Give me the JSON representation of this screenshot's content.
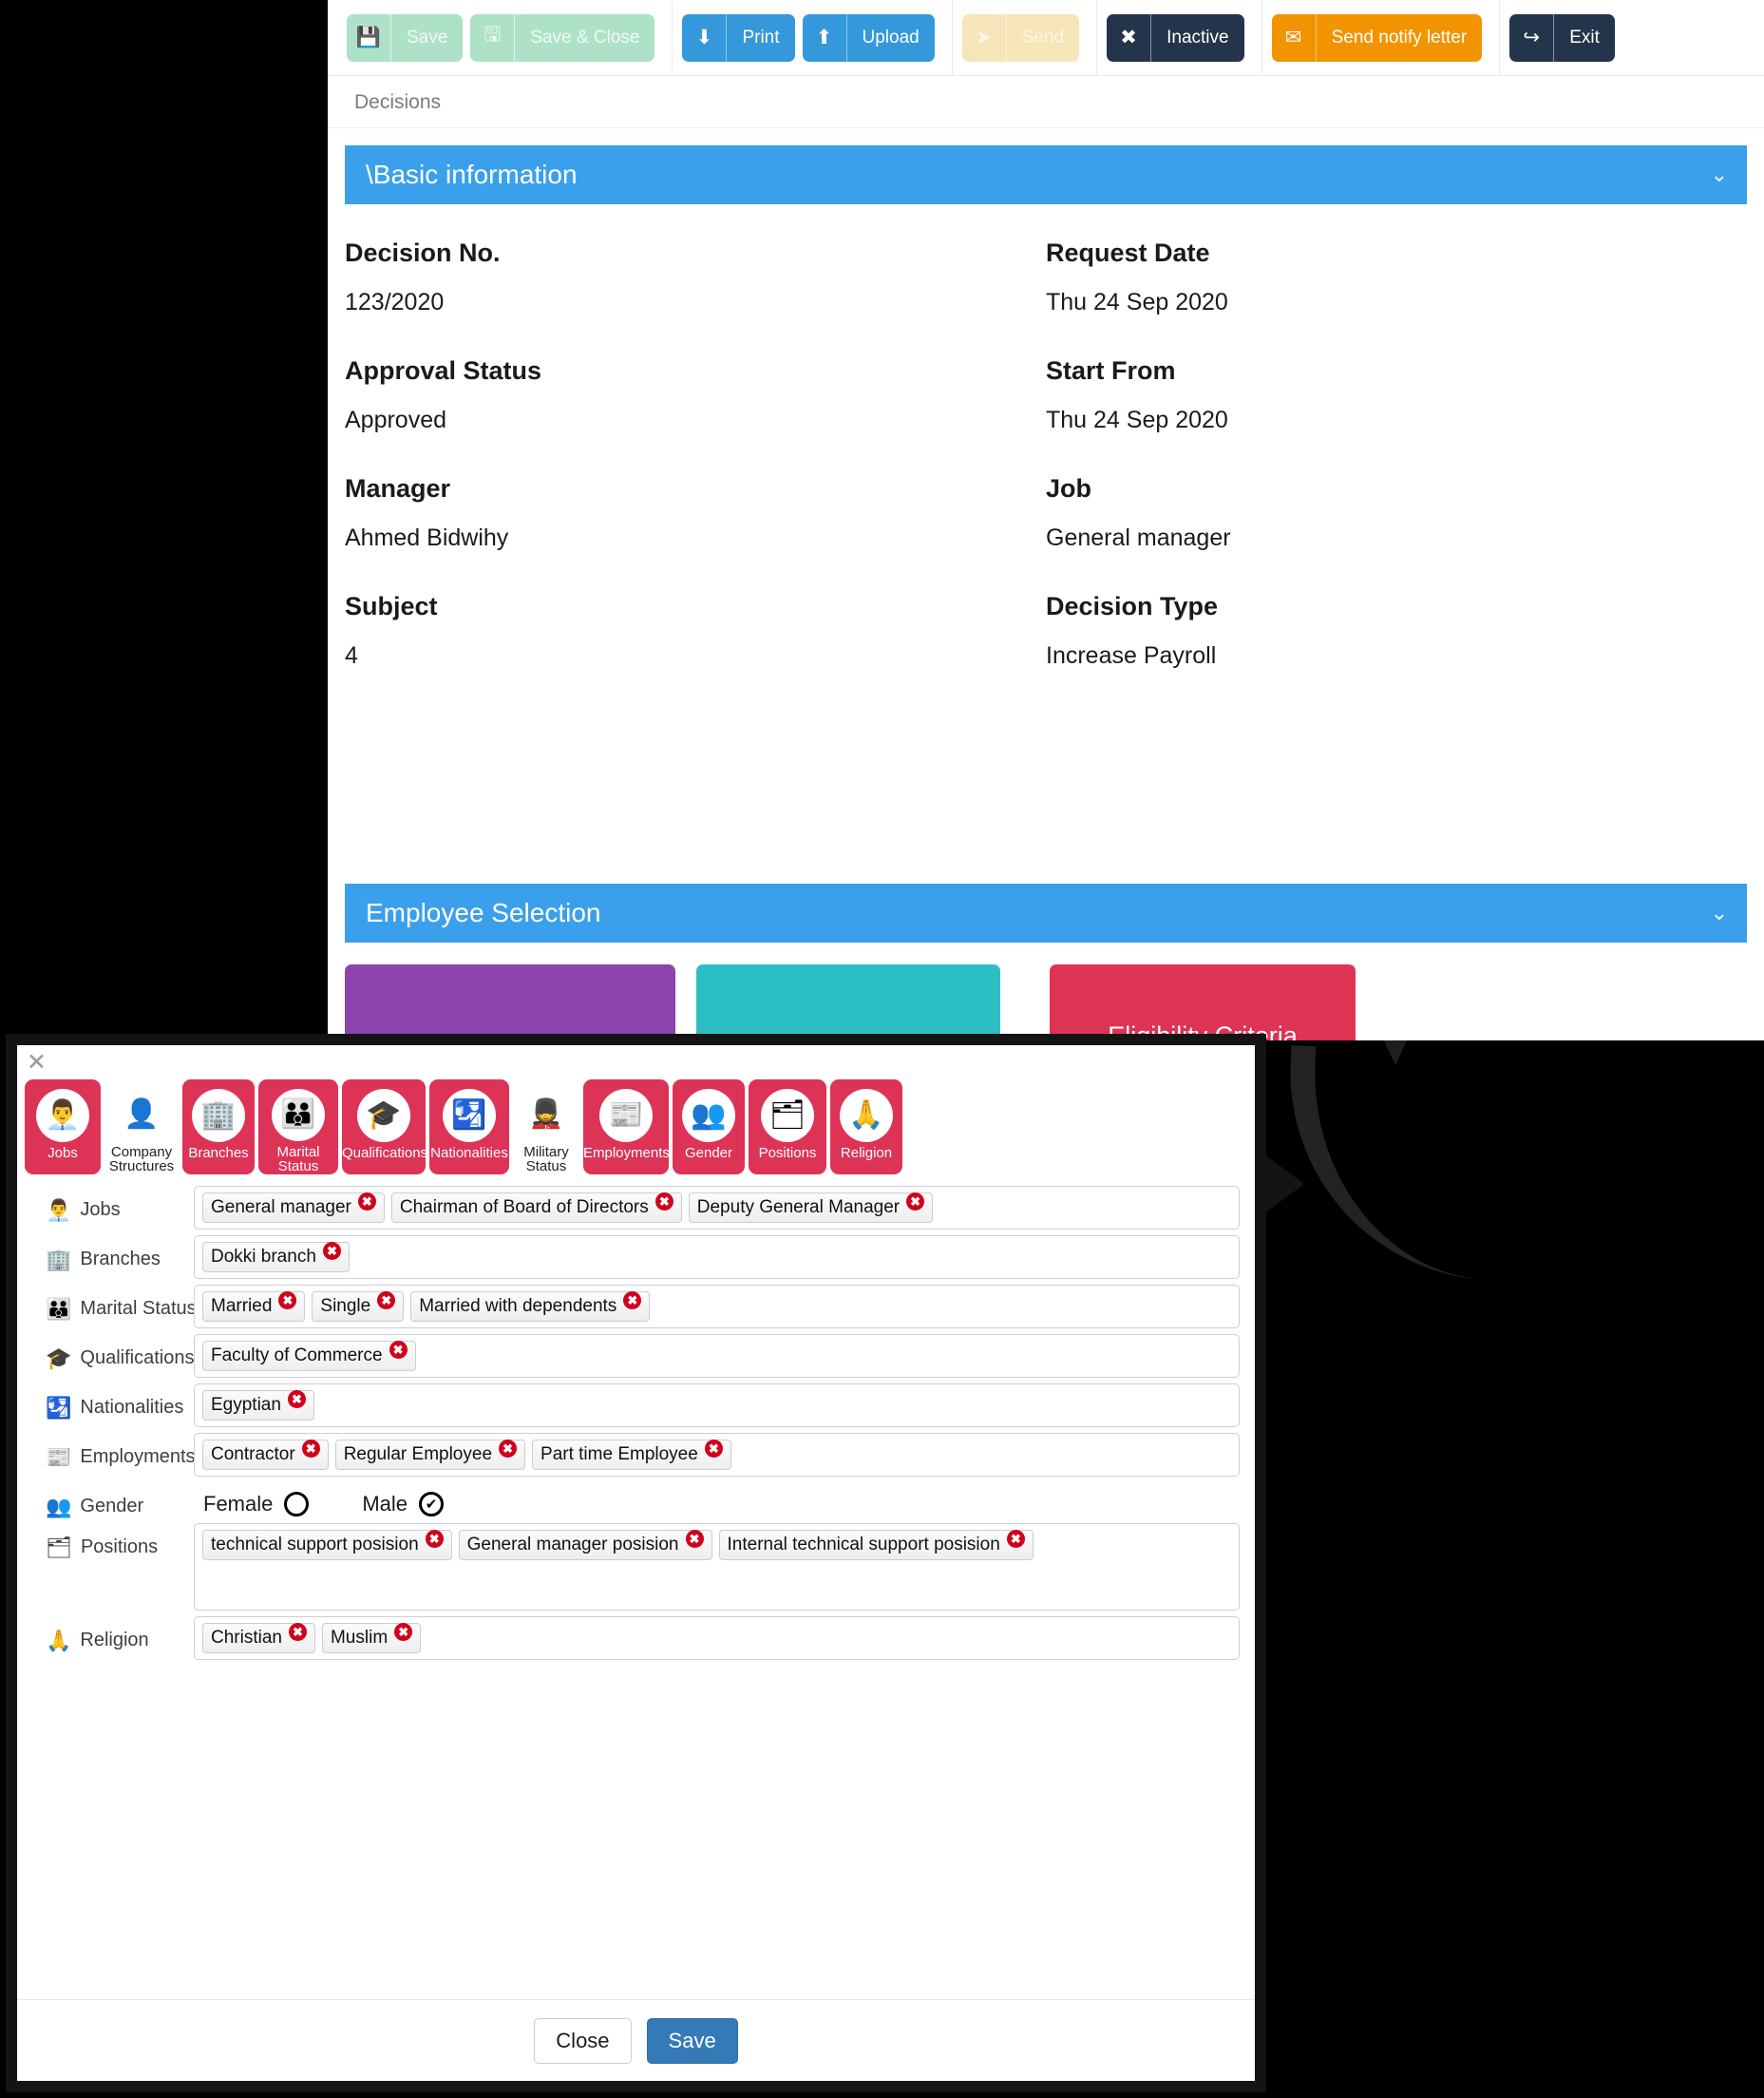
{
  "toolbar": {
    "groups": [
      {
        "buttons": [
          {
            "label": "Save",
            "icon": "save-icon",
            "glyph": "💾",
            "style": "mint",
            "name": "save-button"
          },
          {
            "label": "Save & Close",
            "icon": "save-close-icon",
            "glyph": "🖫",
            "style": "mint",
            "name": "save-close-button"
          }
        ]
      },
      {
        "buttons": [
          {
            "label": "Print",
            "icon": "print-download-icon",
            "glyph": "⬇",
            "style": "blue",
            "name": "print-button"
          },
          {
            "label": "Upload",
            "icon": "upload-icon",
            "glyph": "⬆",
            "style": "blue",
            "name": "upload-button"
          }
        ]
      },
      {
        "buttons": [
          {
            "label": "Send",
            "icon": "send-paper-plane-icon",
            "glyph": "➤",
            "style": "sand",
            "name": "send-button"
          }
        ]
      },
      {
        "buttons": [
          {
            "label": "Inactive",
            "icon": "x-mark-icon",
            "glyph": "✖",
            "style": "navy",
            "name": "inactive-button"
          }
        ]
      },
      {
        "buttons": [
          {
            "label": "Send notify letter",
            "icon": "envelope-icon",
            "glyph": "✉",
            "style": "orange",
            "name": "send-notify-letter-button"
          }
        ]
      },
      {
        "buttons": [
          {
            "label": "Exit",
            "icon": "exit-logout-icon",
            "glyph": "↪",
            "style": "navy",
            "name": "exit-button"
          }
        ]
      }
    ]
  },
  "breadcrumb": "Decisions",
  "sections": {
    "basic_information": {
      "title": "\\Basic information",
      "chevron": "⌄",
      "fields": [
        {
          "label": "Decision No.",
          "value": "123/2020"
        },
        {
          "label": "Request Date",
          "value": "Thu 24 Sep 2020"
        },
        {
          "label": "Approval Status",
          "value": "Approved"
        },
        {
          "label": "Start From",
          "value": "Thu 24 Sep 2020"
        },
        {
          "label": "Manager",
          "value": "Ahmed Bidwihy"
        },
        {
          "label": "Job",
          "value": "General manager"
        },
        {
          "label": "Subject",
          "value": "4"
        },
        {
          "label": "Decision Type",
          "value": "Increase Payroll"
        }
      ]
    },
    "employee_selection": {
      "title": "Employee Selection",
      "chevron": "⌄",
      "cards": [
        {
          "label": "",
          "color": "#8e44ad",
          "name": "employee-card-purple"
        },
        {
          "label": "",
          "color": "#2bbfc4",
          "name": "employee-card-teal"
        },
        {
          "label": "Eligibility Criteria",
          "color": "#dd3354",
          "name": "eligibility-criteria-card"
        }
      ]
    }
  },
  "modal": {
    "close_glyph": "✕",
    "tabs": [
      {
        "label": "Jobs",
        "glyph": "👨‍💼",
        "active": true,
        "icon": "jobs-icon",
        "cls": "w-jobs"
      },
      {
        "label": "Company Structures",
        "glyph": "👤",
        "active": false,
        "icon": "company-structures-icon",
        "cls": "w-company"
      },
      {
        "label": "Branches",
        "glyph": "🏢",
        "active": true,
        "icon": "branches-icon",
        "cls": "w-branches"
      },
      {
        "label": "Marital Status",
        "glyph": "👪",
        "active": true,
        "icon": "marital-status-icon",
        "cls": "w-marital"
      },
      {
        "label": "Qualifications",
        "glyph": "🎓",
        "active": true,
        "icon": "qualifications-icon",
        "cls": "w-qual"
      },
      {
        "label": "Nationalities",
        "glyph": "🛂",
        "active": true,
        "icon": "nationalities-icon",
        "cls": "w-nation"
      },
      {
        "label": "Military Status",
        "glyph": "💂",
        "active": false,
        "icon": "military-status-icon",
        "cls": "w-military"
      },
      {
        "label": "Employments",
        "glyph": "📰",
        "active": true,
        "icon": "employments-icon",
        "cls": "w-employ"
      },
      {
        "label": "Gender",
        "glyph": "👥",
        "active": true,
        "icon": "gender-icon",
        "cls": "w-gender"
      },
      {
        "label": "Positions",
        "glyph": "🗂",
        "active": true,
        "icon": "positions-icon",
        "cls": "w-positions"
      },
      {
        "label": "Religion",
        "glyph": "🙏",
        "active": true,
        "icon": "religion-icon",
        "cls": "w-religion"
      }
    ],
    "rows": [
      {
        "label": "Jobs",
        "glyph": "👨‍💼",
        "icon": "jobs-icon",
        "type": "tags",
        "tall": false,
        "tags": [
          "General manager",
          "Chairman of Board of Directors",
          "Deputy General Manager"
        ]
      },
      {
        "label": "Branches",
        "glyph": "🏢",
        "icon": "branches-icon",
        "type": "tags",
        "tall": false,
        "tags": [
          "Dokki branch"
        ]
      },
      {
        "label": "Marital Status",
        "glyph": "👪",
        "icon": "marital-status-icon",
        "type": "tags",
        "tall": false,
        "tags": [
          "Married",
          "Single",
          "Married with dependents"
        ]
      },
      {
        "label": "Qualifications",
        "glyph": "🎓",
        "icon": "qualifications-icon",
        "type": "tags",
        "tall": false,
        "tags": [
          "Faculty of Commerce"
        ]
      },
      {
        "label": "Nationalities",
        "glyph": "🛂",
        "icon": "nationalities-icon",
        "type": "tags",
        "tall": false,
        "tags": [
          "Egyptian"
        ]
      },
      {
        "label": "Employments",
        "glyph": "📰",
        "icon": "employments-icon",
        "type": "tags",
        "tall": false,
        "tags": [
          "Contractor",
          "Regular Employee",
          "Part time Employee"
        ]
      },
      {
        "label": "Gender",
        "glyph": "👥",
        "icon": "gender-icon",
        "type": "radio",
        "options": [
          {
            "label": "Female",
            "selected": false
          },
          {
            "label": "Male",
            "selected": true
          }
        ]
      },
      {
        "label": "Positions",
        "glyph": "🗂",
        "icon": "positions-icon",
        "type": "tags",
        "tall": true,
        "tags": [
          "technical support posision",
          "General manager posision",
          "Internal technical support posision"
        ]
      },
      {
        "label": "Religion",
        "glyph": "🙏",
        "icon": "religion-icon",
        "type": "tags",
        "tall": false,
        "tags": [
          "Christian",
          "Muslim"
        ]
      }
    ],
    "footer": {
      "close_label": "Close",
      "save_label": "Save"
    },
    "tag_remove_glyph": "✖"
  },
  "colors": {
    "accent_blue": "#3aa0ec",
    "crimson": "#dd3356",
    "navy": "#24344a",
    "orange": "#f29400",
    "mint": "#aee2c8",
    "sand": "#f5e5b8",
    "purple": "#8e44ad",
    "teal": "#2bbfc4",
    "primary_button": "#337ab7"
  }
}
